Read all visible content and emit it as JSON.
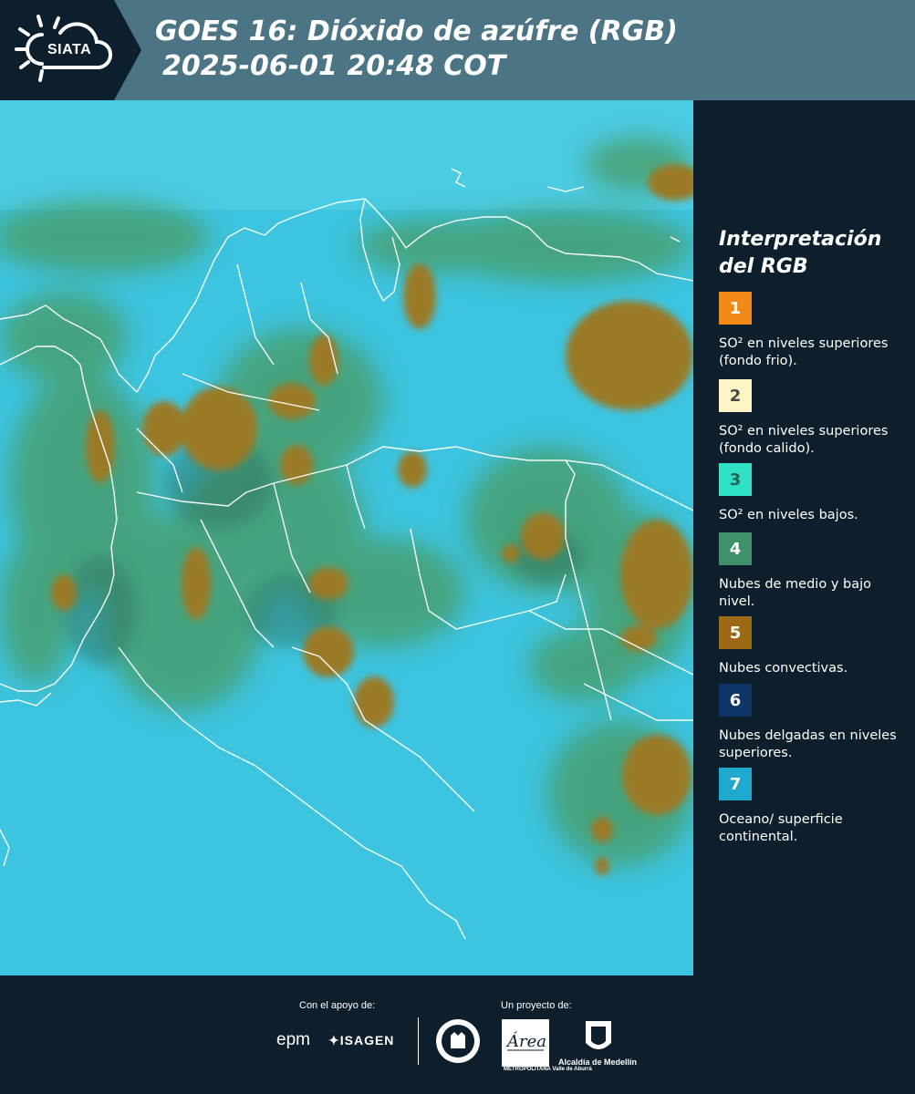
{
  "header": {
    "logo_text": "SIATA",
    "title_line1": "GOES 16: Dióxido de azúfre (RGB)",
    "title_line2": "2025-06-01 20:48 COT"
  },
  "legend": {
    "title": "Interpretación del RGB",
    "items": [
      {
        "number": "1",
        "color": "#f28a1a",
        "num_color": "#ffffff",
        "description": "SO² en niveles superiores (fondo frio)."
      },
      {
        "number": "2",
        "color": "#fdf5c4",
        "num_color": "#4a4a4a",
        "description": "SO² en niveles superiores (fondo calido)."
      },
      {
        "number": "3",
        "color": "#2fe2c6",
        "num_color": "#2b5f5a",
        "description": "SO² en niveles bajos."
      },
      {
        "number": "4",
        "color": "#3e8f6a",
        "num_color": "#ffffff",
        "description": "Nubes de medio y bajo nivel."
      },
      {
        "number": "5",
        "color": "#9c6a14",
        "num_color": "#ffffff",
        "description": "Nubes convectivas."
      },
      {
        "number": "6",
        "color": "#0e3566",
        "num_color": "#ffffff",
        "description": "Nubes delgadas en niveles superiores."
      },
      {
        "number": "7",
        "color": "#1fa9cf",
        "num_color": "#ffffff",
        "description": "Oceano/ superficie continental."
      }
    ]
  },
  "footer": {
    "support_label": "Con el apoyo de:",
    "project_label": "Un proyecto de:",
    "sponsors": [
      "epm",
      "ISAGEN"
    ],
    "partners": [
      "METROPOLITANA Valle de Aburrá",
      "Alcaldía de Medellín"
    ],
    "area_logo_text": "Área"
  },
  "map": {
    "background_color": "#3ec8e2",
    "cloud_color": "#9c7a24",
    "low_cloud_color": "#4d9a5c"
  }
}
